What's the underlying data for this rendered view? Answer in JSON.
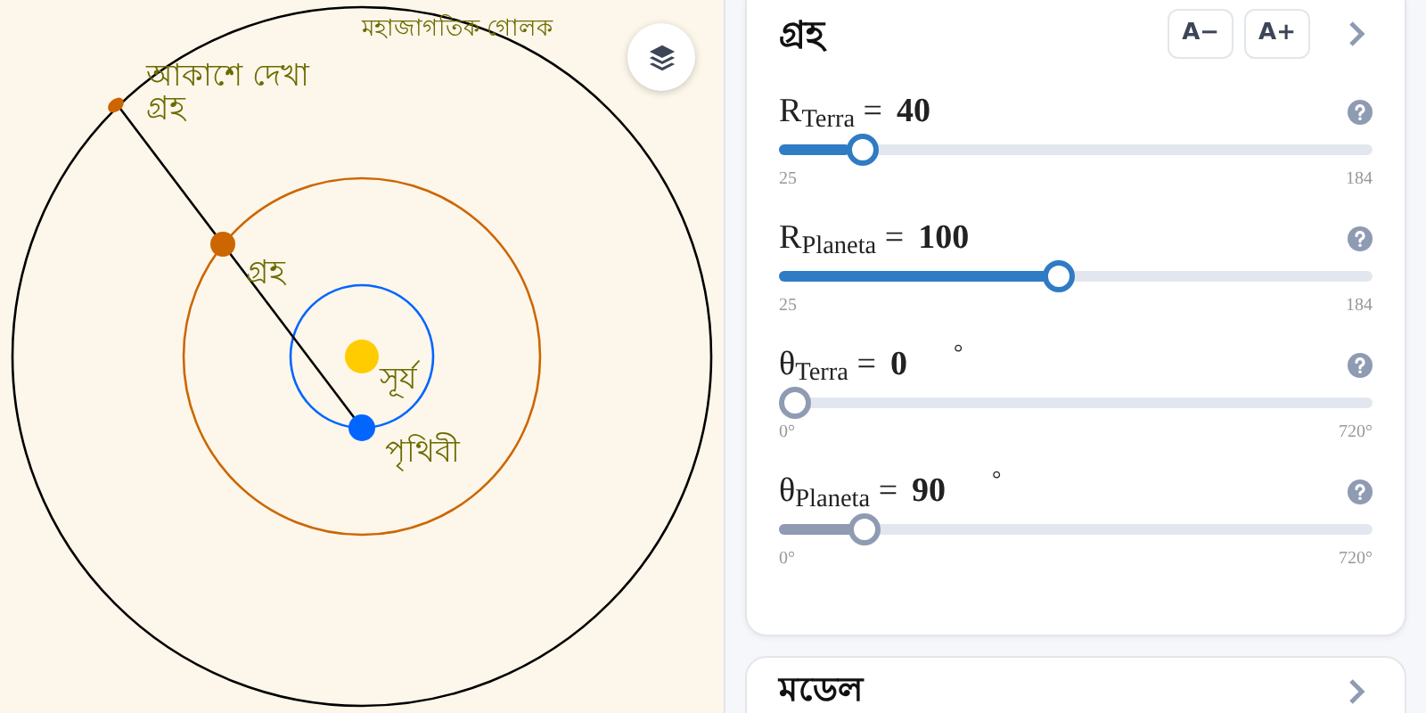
{
  "canvas": {
    "labels": [
      {
        "kind": "sphere",
        "text": "মহাজাগতিক গোলক"
      },
      {
        "kind": "seen",
        "lines": [
          "আকাশে দেখা",
          "গ্রহ"
        ]
      },
      {
        "kind": "planet",
        "text": "গ্রহ"
      },
      {
        "kind": "sun",
        "text": "সূর্য"
      },
      {
        "kind": "earth",
        "text": "পৃথিবী"
      }
    ]
  },
  "panel": {
    "title": "গ্রহ",
    "buttons": [
      "A−",
      "A+"
    ],
    "sliders": [
      {
        "label": "R$_{Terra}$ =",
        "value": "40",
        "min": "25",
        "max": "184",
        "level": 0.12,
        "color": "#2f7bc4"
      },
      {
        "label": "R$_{Planeta}$ =",
        "value": "100",
        "min": "25",
        "max": "184",
        "level": 0.47,
        "color": "#2f7bc4"
      },
      {
        "label": "θ$_{Terra}$ =",
        "value": "0",
        "unit": "°",
        "min": "0°",
        "max": "720°",
        "level": 0,
        "color": "#8f9bb3"
      },
      {
        "label": "θ$_{Planeta}$ =",
        "value": "90",
        "unit": "°",
        "min": "0°",
        "max": "720°",
        "level": 0.125,
        "color": "#8f9bb3"
      }
    ]
  },
  "next_card": {
    "title": "মডেল"
  }
}
